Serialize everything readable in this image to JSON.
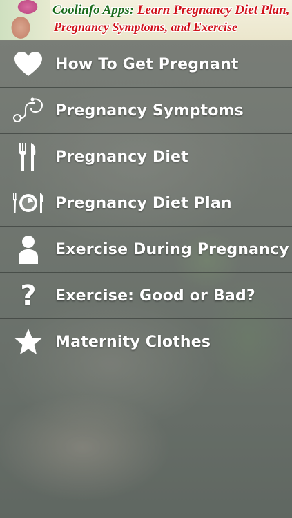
{
  "banner": {
    "brand": "Coolinfo Apps:",
    "title_line1": "Learn Pregnancy Diet Plan,",
    "title_line2": "Pregnancy Symptoms, and Exercise"
  },
  "menu": {
    "items": [
      {
        "label": "How To Get Pregnant",
        "icon": "heart-icon"
      },
      {
        "label": "Pregnancy Symptoms",
        "icon": "stethoscope-icon"
      },
      {
        "label": "Pregnancy Diet",
        "icon": "fork-knife-icon"
      },
      {
        "label": "Pregnancy Diet Plan",
        "icon": "clock-plate-icon"
      },
      {
        "label": "Exercise During Pregnancy",
        "icon": "person-icon"
      },
      {
        "label": "Exercise: Good or Bad?",
        "icon": "question-icon",
        "glyph": "?"
      },
      {
        "label": "Maternity Clothes",
        "icon": "star-icon"
      }
    ]
  }
}
